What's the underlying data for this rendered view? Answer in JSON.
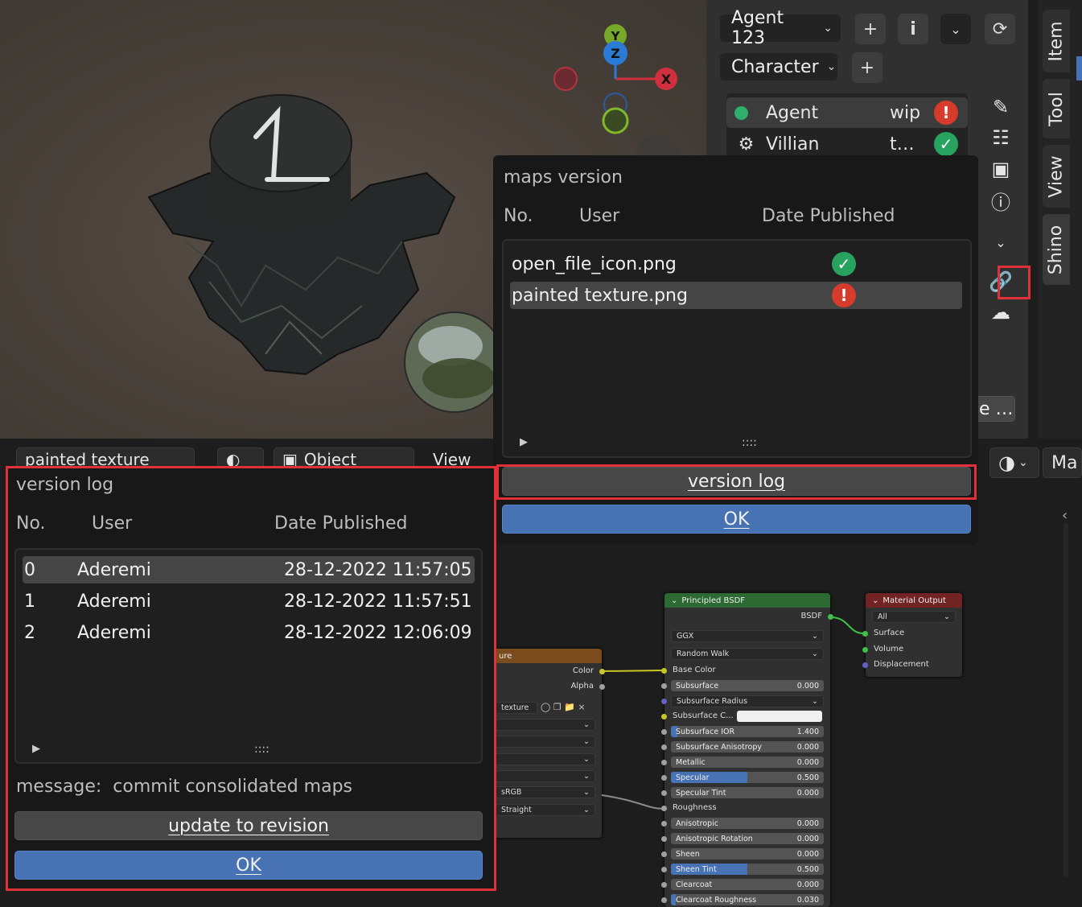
{
  "viewport": {
    "gizmo": {
      "x": "X",
      "y": "Y",
      "z": "Z"
    }
  },
  "npanel": {
    "agent_selector": "Agent 123",
    "character_selector": "Character",
    "agents": [
      {
        "name": "Agent",
        "status_text": "wip",
        "status": "error"
      },
      {
        "name": "Villian",
        "status_text": "t…",
        "status": "ok"
      }
    ],
    "truncated_button": "e …",
    "tabs": [
      "Item",
      "Tool",
      "View",
      "Shino"
    ]
  },
  "maps_popup": {
    "title": "maps version",
    "columns": {
      "no": "No.",
      "user": "User",
      "date": "Date Published"
    },
    "files": [
      {
        "name": "open_file_icon.png",
        "status": "ok"
      },
      {
        "name": "painted texture.png",
        "status": "error"
      }
    ],
    "resize_handle": "::::",
    "version_log_button": "version log",
    "ok_button": "OK"
  },
  "version_log": {
    "title": "version log",
    "columns": {
      "no": "No.",
      "user": "User",
      "date": "Date Published"
    },
    "rows": [
      {
        "no": "0",
        "user": "Aderemi",
        "date": "28-12-2022 11:57:05"
      },
      {
        "no": "1",
        "user": "Aderemi",
        "date": "28-12-2022 11:57:51"
      },
      {
        "no": "2",
        "user": "Aderemi",
        "date": "28-12-2022 12:06:09"
      }
    ],
    "resize_handle": "::::",
    "message_label": "message:",
    "message": "commit consolidated maps",
    "update_button": "update to revision",
    "ok_button": "OK"
  },
  "node_header": {
    "image_name": "painted texture",
    "object_menu": "Object",
    "view_menu": "View",
    "material_label": "Ma"
  },
  "image_node": {
    "title": "ure",
    "outputs": [
      "Color",
      "Alpha"
    ],
    "image_field": "texture",
    "colorspace": "sRGB",
    "alpha": "Straight"
  },
  "bsdf_node": {
    "title": "Principled BSDF",
    "output": "BSDF",
    "distribution": "GGX",
    "subsurface_method": "Random Walk",
    "inputs": [
      {
        "label": "Base Color"
      },
      {
        "label": "Subsurface",
        "value": "0.000",
        "fill": 0
      },
      {
        "label": "Subsurface Radius",
        "dropdown": true
      },
      {
        "label": "Subsurface C...",
        "color": "#f0f0f0"
      },
      {
        "label": "Subsurface IOR",
        "value": "1.400",
        "fill": 0.04
      },
      {
        "label": "Subsurface Anisotropy",
        "value": "0.000",
        "fill": 0
      },
      {
        "label": "Metallic",
        "value": "0.000",
        "fill": 0
      },
      {
        "label": "Specular",
        "value": "0.500",
        "fill": 0.5
      },
      {
        "label": "Specular Tint",
        "value": "0.000",
        "fill": 0
      },
      {
        "label": "Roughness",
        "plain": true
      },
      {
        "label": "Anisotropic",
        "value": "0.000",
        "fill": 0
      },
      {
        "label": "Anisotropic Rotation",
        "value": "0.000",
        "fill": 0
      },
      {
        "label": "Sheen",
        "value": "0.000",
        "fill": 0
      },
      {
        "label": "Sheen Tint",
        "value": "0.500",
        "fill": 0.5
      },
      {
        "label": "Clearcoat",
        "value": "0.000",
        "fill": 0
      },
      {
        "label": "Clearcoat Roughness",
        "value": "0.030",
        "fill": 0.03
      }
    ]
  },
  "output_node": {
    "title": "Material Output",
    "target": "All",
    "inputs": [
      "Surface",
      "Volume",
      "Displacement"
    ]
  },
  "colors": {
    "accent_blue": "#4772b3",
    "highlight_red": "#e0313b",
    "ok_green": "#27a35f",
    "error_red": "#d63b2b",
    "bsdf_header": "#2d6a33",
    "output_header": "#722424",
    "texture_header": "#7a4b1c"
  }
}
